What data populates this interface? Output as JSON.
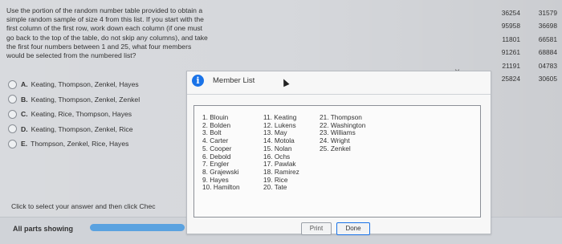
{
  "question": {
    "lines": [
      "Use the portion of the random number table provided to obtain a",
      "simple random sample of size 4 from this list. If you start with the",
      "first column of the first row, work down each column (if one must",
      "go back to the top of the table, do not skip any columns), and take",
      "the first four numbers between 1 and 25, what four members",
      "would be selected from the numbered list?"
    ]
  },
  "random_table": {
    "rows": [
      [
        "36254",
        "31579"
      ],
      [
        "95958",
        "36698"
      ],
      [
        "11801",
        "66581"
      ],
      [
        "91261",
        "68884"
      ],
      [
        "21191",
        "04783"
      ],
      [
        "25824",
        "30605"
      ]
    ]
  },
  "options": [
    {
      "letter": "A.",
      "text": "Keating, Thompson, Zenkel, Hayes"
    },
    {
      "letter": "B.",
      "text": "Keating, Thompson, Zenkel, Zenkel"
    },
    {
      "letter": "C.",
      "text": "Keating, Rice, Thompson, Hayes"
    },
    {
      "letter": "D.",
      "text": "Keating, Thompson, Zenkel, Rice"
    },
    {
      "letter": "E.",
      "text": "Thompson, Zenkel, Rice, Hayes"
    }
  ],
  "footer": {
    "instruction": "Click to select your answer and then click Chec",
    "parts_label": "All parts showing"
  },
  "window_controls": {
    "minimize": "-",
    "close": "×"
  },
  "modal": {
    "title": "Member List",
    "columns": [
      [
        "1. Blouin",
        "2. Bolden",
        "3. Bolt",
        "4. Carter",
        "5. Cooper",
        "6. Debold",
        "7. Engler",
        "8. Grajewski",
        "9. Hayes",
        "10. Hamilton"
      ],
      [
        "11. Keating",
        "12. Lukens",
        "13. May",
        "14. Motola",
        "15. Nolan",
        "16. Ochs",
        "17. Pawlak",
        "18. Ramirez",
        "19. Rice",
        "20. Tate"
      ],
      [
        "21. Thompson",
        "22. Washington",
        "23. Williams",
        "24. Wright",
        "25. Zenkel"
      ]
    ],
    "print_label": "Print",
    "done_label": "Done"
  },
  "colors": {
    "accent": "#1a73e8",
    "progress": "#5aa2e0"
  }
}
